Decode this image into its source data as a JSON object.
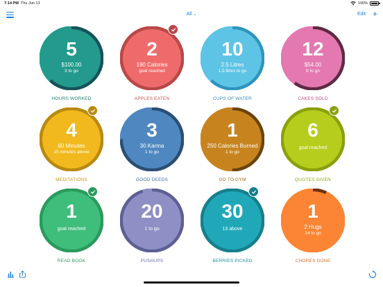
{
  "status": {
    "time": "7:14 PM",
    "date": "Thu Jun 13",
    "battery": "100%"
  },
  "nav": {
    "filter_label": "All",
    "edit_label": "Edit",
    "add_label": "+"
  },
  "tiles": [
    {
      "count": "5",
      "line1": "$100.00",
      "line2": "3 to go",
      "label": "HOURS WORKED",
      "color": "#239a8c",
      "ring": "#16535a",
      "label_color": "#1d7a73",
      "progress": 0.62,
      "done": false
    },
    {
      "count": "2",
      "line1": "190 Calories",
      "line2": "goal reached",
      "label": "APPLES EATEN",
      "color": "#ef6b6b",
      "ring": "#b94848",
      "label_color": "#c9504f",
      "progress": 1.0,
      "done": true
    },
    {
      "count": "10",
      "line1": "2.5 Litres",
      "line2": "1.5 litres to go",
      "label": "CUPS OF WATER",
      "color": "#5ec4e5",
      "ring": "#2d95be",
      "label_color": "#2f89b3",
      "progress": 0.62,
      "done": false
    },
    {
      "count": "12",
      "line1": "$54.00",
      "line2": "8 to go",
      "label": "CAKES SOLD",
      "color": "#e478b0",
      "ring": "#5e2a43",
      "label_color": "#b8457f",
      "progress": 0.6,
      "done": false
    },
    {
      "count": "4",
      "line1": "60 Minutes",
      "line2": "15 minutes above",
      "label": "MEDITATIONS",
      "color": "#f1b91d",
      "ring": "#b98912",
      "label_color": "#c9940e",
      "progress": 1.0,
      "done": true
    },
    {
      "count": "3",
      "line1": "30 Karma",
      "line2": "1 to go",
      "label": "GOOD DEEDS",
      "color": "#4f87c0",
      "ring": "#2b4e74",
      "label_color": "#3b6fa4",
      "progress": 0.75,
      "done": false
    },
    {
      "count": "1",
      "line1": "250 Calories Burned",
      "line2": "1 to go",
      "label": "GO TO GYM",
      "color": "#c7841e",
      "ring": "#6b440d",
      "label_color": "#9e6614",
      "progress": 0.5,
      "done": false
    },
    {
      "count": "6",
      "line1": "",
      "line2": "",
      "only": "goal reached",
      "label": "QUOTES GIVEN",
      "color": "#b7cd1d",
      "ring": "#8aa00c",
      "label_color": "#8d9f10",
      "progress": 1.0,
      "done": true
    },
    {
      "count": "1",
      "line1": "",
      "line2": "",
      "only": "goal reached",
      "label": "READ BOOK",
      "color": "#3fbd7a",
      "ring": "#2a9a5d",
      "label_color": "#2b9a60",
      "progress": 1.0,
      "done": true
    },
    {
      "count": "20",
      "line1": "",
      "line2": "",
      "only": "1 to go",
      "label": "PUSHUPS",
      "color": "#8e8fc4",
      "ring": "#5e5f94",
      "label_color": "#6b6ca4",
      "progress": 0.95,
      "done": false
    },
    {
      "count": "30",
      "line1": "",
      "line2": "",
      "only": "13 above",
      "label": "BERRIES PICKED",
      "color": "#20a8b8",
      "ring": "#167f8c",
      "label_color": "#178a98",
      "progress": 1.0,
      "done": true
    },
    {
      "count": "1",
      "line1": "2 Hugs",
      "line2": "14 to go",
      "label": "CHORES DONE",
      "color": "#fb8534",
      "ring": "#6a3210",
      "label_color": "#d46c20",
      "progress": 0.07,
      "done": false
    }
  ],
  "icons": {
    "menu": "hamburger-menu-icon",
    "stats": "bar-chart-icon",
    "share": "share-icon",
    "refresh": "refresh-icon",
    "check": "checkmark-icon"
  }
}
